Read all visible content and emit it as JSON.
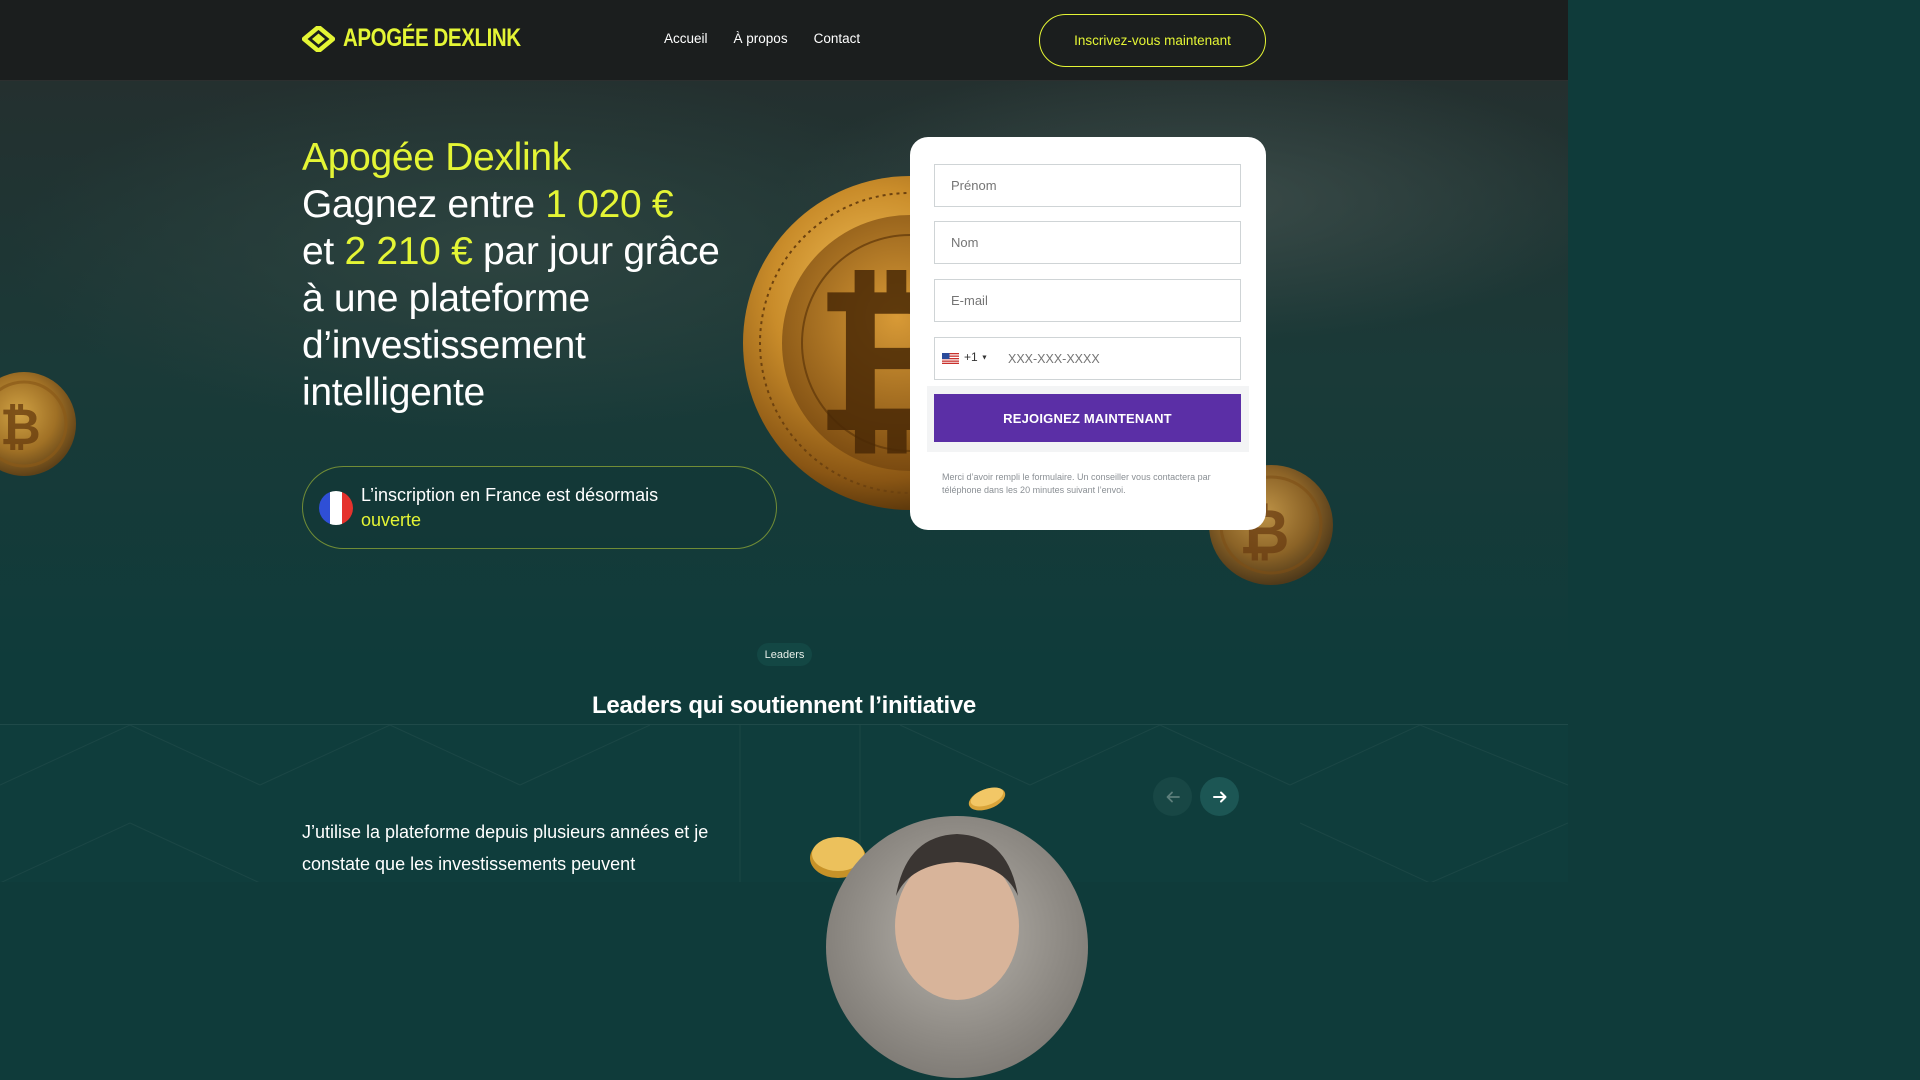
{
  "header": {
    "brand": "APOGÉE DEXLINK",
    "nav": [
      "Accueil",
      "À propos",
      "Contact"
    ],
    "cta_label": "Inscrivez-vous maintenant",
    "accent_color": "#e4f535"
  },
  "hero": {
    "title_brand": "Apogée Dexlink",
    "title_part1": "Gagnez entre ",
    "amount_min": "1 020 €",
    "title_part2": "et ",
    "amount_max": "2 210 €",
    "title_part3": " par jour grâce à une plateforme d’investissement intelligente",
    "france_text": "L’inscription en France est désormais",
    "france_accent": "ouverte"
  },
  "form": {
    "first_name_placeholder": "Prénom",
    "last_name_placeholder": "Nom",
    "email_placeholder": "E-mail",
    "dial_code": "+1",
    "phone_placeholder": "XXX-XXX-XXXX",
    "submit_label": "REJOIGNEZ MAINTENANT",
    "submit_color": "#5b2fa6",
    "note": "Merci d’avoir rempli le formulaire. Un conseiller vous contactera par téléphone dans les 20 minutes suivant l’envoi."
  },
  "leaders": {
    "pill": "Leaders",
    "title": "Leaders qui soutiennent l’initiative",
    "testimonial": "J’utilise la plateforme depuis plusieurs années et je constate que les investissements peuvent"
  },
  "icons": [
    "logo-icon",
    "chevron-down-icon",
    "arrow-left-icon",
    "arrow-right-icon",
    "bitcoin-coin-icon",
    "france-flag-icon",
    "us-flag-icon"
  ]
}
